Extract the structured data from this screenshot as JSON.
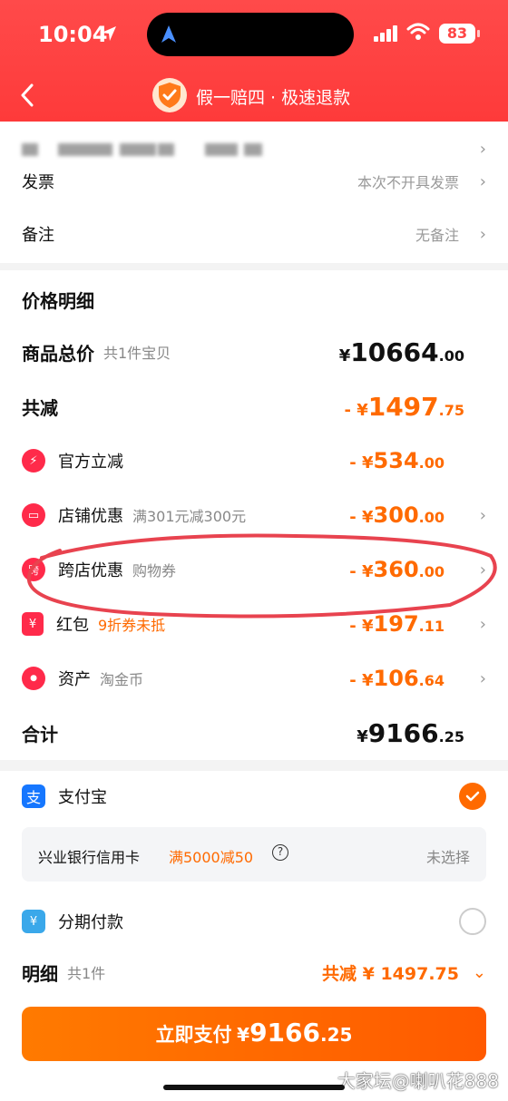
{
  "status_bar": {
    "time": "10:04",
    "battery": "83"
  },
  "header": {
    "title": "假一赔四 · 极速退款"
  },
  "order_info": {
    "invoice_label": "发票",
    "invoice_value": "本次不开具发票",
    "remark_label": "备注",
    "remark_value": "无备注"
  },
  "price": {
    "section_title": "价格明细",
    "goods": {
      "label": "商品总价",
      "sub": "共1件宝贝",
      "currency": "¥",
      "int": "10664",
      "dec": ".00"
    },
    "reduce": {
      "label": "共减",
      "prefix": "- ¥",
      "int": "1497",
      "dec": ".75"
    },
    "items": [
      {
        "label": "官方立减",
        "sub": "",
        "prefix": "- ¥",
        "int": "534",
        "dec": ".00",
        "icon": "lightning-icon",
        "icon_char": "⚡"
      },
      {
        "label": "店铺优惠",
        "sub": "满301元减300元",
        "prefix": "- ¥",
        "int": "300",
        "dec": ".00",
        "icon": "shop-icon",
        "icon_char": "▭"
      },
      {
        "label": "跨店优惠",
        "sub": "购物券",
        "prefix": "- ¥",
        "int": "360",
        "dec": ".00",
        "icon": "cross-store-icon",
        "icon_char": "跨"
      },
      {
        "label": "红包",
        "sub": "9折券未抵",
        "prefix": "- ¥",
        "int": "197",
        "dec": ".11",
        "icon": "red-packet-icon",
        "icon_char": "¥"
      },
      {
        "label": "资产",
        "sub": "淘金币",
        "prefix": "- ¥",
        "int": "106",
        "dec": ".64",
        "icon": "tag-icon",
        "icon_char": "●"
      }
    ],
    "total": {
      "label": "合计",
      "currency": "¥",
      "int": "9166",
      "dec": ".25"
    }
  },
  "payment": {
    "alipay_label": "支付宝",
    "bank_label": "兴业银行信用卡",
    "bank_promo": "满5000减50",
    "bank_status": "未选择",
    "installment_label": "分期付款",
    "detail_label": "明细",
    "detail_sub": "共1件",
    "detail_reduce": "共减 ¥ 1497.75",
    "pay_button": {
      "label": "立即支付",
      "currency": "¥",
      "int": "9166",
      "dec": ".25"
    }
  },
  "watermark": "大家坛@喇叭花888",
  "colors": {
    "brand_red": "#fe3a3a",
    "accent_orange": "#ff6a00",
    "alipay_blue": "#1677ff"
  }
}
